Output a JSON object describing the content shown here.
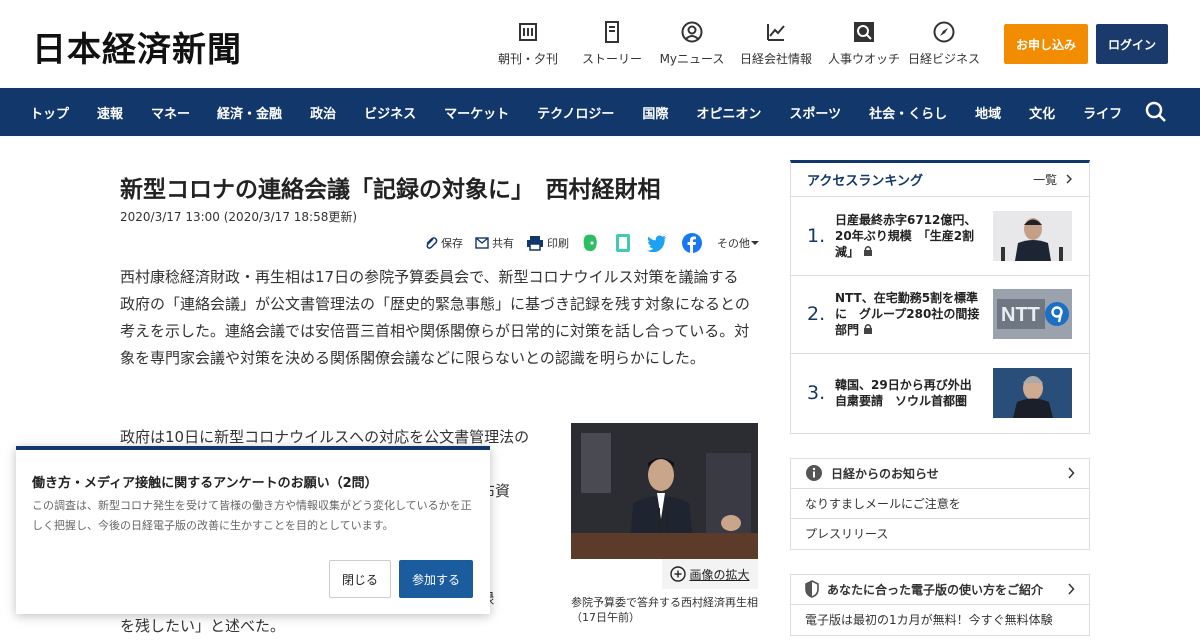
{
  "header": {
    "logo": "日本経済新聞",
    "links": [
      {
        "label": "朝刊・夕刊",
        "icon": "newspaper-icon"
      },
      {
        "label": "ストーリー",
        "icon": "story-icon"
      },
      {
        "label": "Myニュース",
        "icon": "user-icon"
      },
      {
        "label": "日経会社情報",
        "icon": "chart-icon"
      },
      {
        "label": "人事ウオッチ",
        "icon": "person-search-icon"
      },
      {
        "label": "日経ビジネス",
        "icon": "compass-icon"
      }
    ],
    "apply_label": "お申し込み",
    "login_label": "ログイン"
  },
  "nav": {
    "items": [
      "トップ",
      "速報",
      "マネー",
      "経済・金融",
      "政治",
      "ビジネス",
      "マーケット",
      "テクノロジー",
      "国際",
      "オピニオン",
      "スポーツ",
      "社会・くらし",
      "地域",
      "文化",
      "ライフ"
    ],
    "search_icon": "search-icon"
  },
  "article": {
    "title": "新型コロナの連絡会議「記録の対象に」　西村経財相",
    "date": "2020/3/17 13:00 (2020/3/17 18:58更新)",
    "share": {
      "save": "保存",
      "share": "共有",
      "print": "印刷",
      "more": "その他"
    },
    "para1": "西村康稔経済財政・再生相は17日の参院予算委員会で、新型コロナウイルス対策を議論する政府の「連絡会議」が公文書管理法の「歴史的緊急事態」に基づき記録を残す対象になるとの考えを示した。連絡会議では安倍晋三首相や関係閣僚らが日常的に対策を話し合っている。対象を専門家会議や対策を決める関係閣僚会議などに限らないとの認識を明らかにした。",
    "para2_lines": [
      "政府は10日に新型コロナウイルスへの対応を公文書管理法の",
      "「歴史的緊急事態」に指定することを決めた。政府",
      "は会議の開催日時や場所、出席者、議題、発言者、配布資",
      "料などの記録を残すことになる。",
      "",
      "西村氏は「連絡会議も新型コロナの議論の会議、関係",
      "閣僚会議の前段階の調整の会議であり、しっかりと記録",
      "を残したい」と述べた。"
    ],
    "photo_caption": "参院予算委で答弁する西村経済再生相（17日午前）",
    "zoom_label": "画像の拡大"
  },
  "sidebar": {
    "ranking_title": "アクセスランキング",
    "ranking_more": "一覧",
    "ranking": [
      {
        "rank": "1.",
        "text": "日産最終赤字6712億円、20年ぶり規模　「生産2割減」",
        "locked": true
      },
      {
        "rank": "2.",
        "text": "NTT、在宅勤務5割を標準に　グループ280社の間接部門",
        "locked": true
      },
      {
        "rank": "3.",
        "text": "韓国、29日から再び外出自粛要請　ソウル首都圏",
        "locked": false
      }
    ],
    "notice_title": "日経からのお知らせ",
    "notices": [
      "なりすましメールにご注意を",
      "プレスリリース"
    ],
    "guide_title": "あなたに合った電子版の使い方をご紹介",
    "guide_text": "電子版は最初の1カ月が無料！今すぐ無料体験"
  },
  "survey": {
    "title": "働き方・メディア接触に関するアンケートのお願い（2問）",
    "desc": "この調査は、新型コロナ発生を受けて皆様の働き方や情報収集がどう変化しているかを正しく把握し、今後の日経電子版の改善に生かすことを目的としています。",
    "close_label": "閉じる",
    "join_label": "参加する"
  },
  "colors": {
    "brand_navy": "#12376b",
    "apply_orange": "#f28c00",
    "join_blue": "#1a5c9e"
  }
}
